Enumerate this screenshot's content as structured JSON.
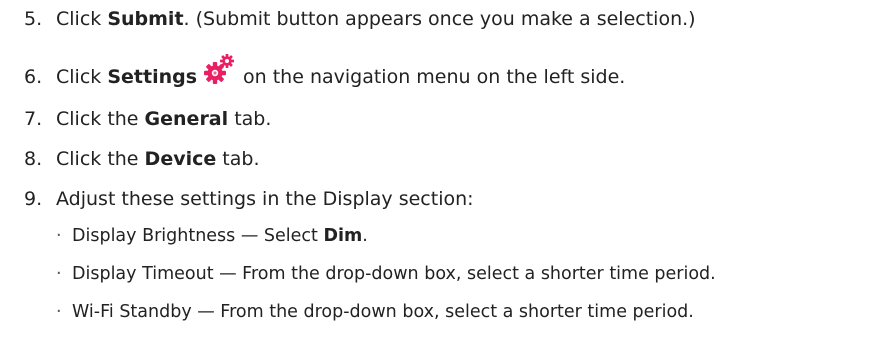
{
  "steps": [
    {
      "num": "5.",
      "pre": "Click ",
      "bold": "Submit",
      "post": ". (Submit button appears once you make a selection.)"
    },
    {
      "num": "6.",
      "pre": "Click ",
      "bold": "Settings",
      "icon": "settings-gear-icon",
      "post": "on the navigation menu on the left side."
    },
    {
      "num": "7.",
      "pre": "Click the ",
      "bold": "General",
      "post": " tab."
    },
    {
      "num": "8.",
      "pre": "Click the ",
      "bold": "Device",
      "post": " tab."
    },
    {
      "num": "9.",
      "text": "Adjust these settings in the Display section:"
    }
  ],
  "substeps": [
    {
      "bullet": "·",
      "pre": "Display Brightness — Select ",
      "bold": "Dim",
      "post": "."
    },
    {
      "bullet": "·",
      "text": "Display Timeout — From the drop-down box, select a shorter time period."
    },
    {
      "bullet": "·",
      "text": "Wi-Fi Standby — From the drop-down box, select a shorter time period."
    }
  ],
  "colors": {
    "text": "#222222",
    "gear_outer": "#E91E63",
    "gear_inner": "#F06292"
  }
}
